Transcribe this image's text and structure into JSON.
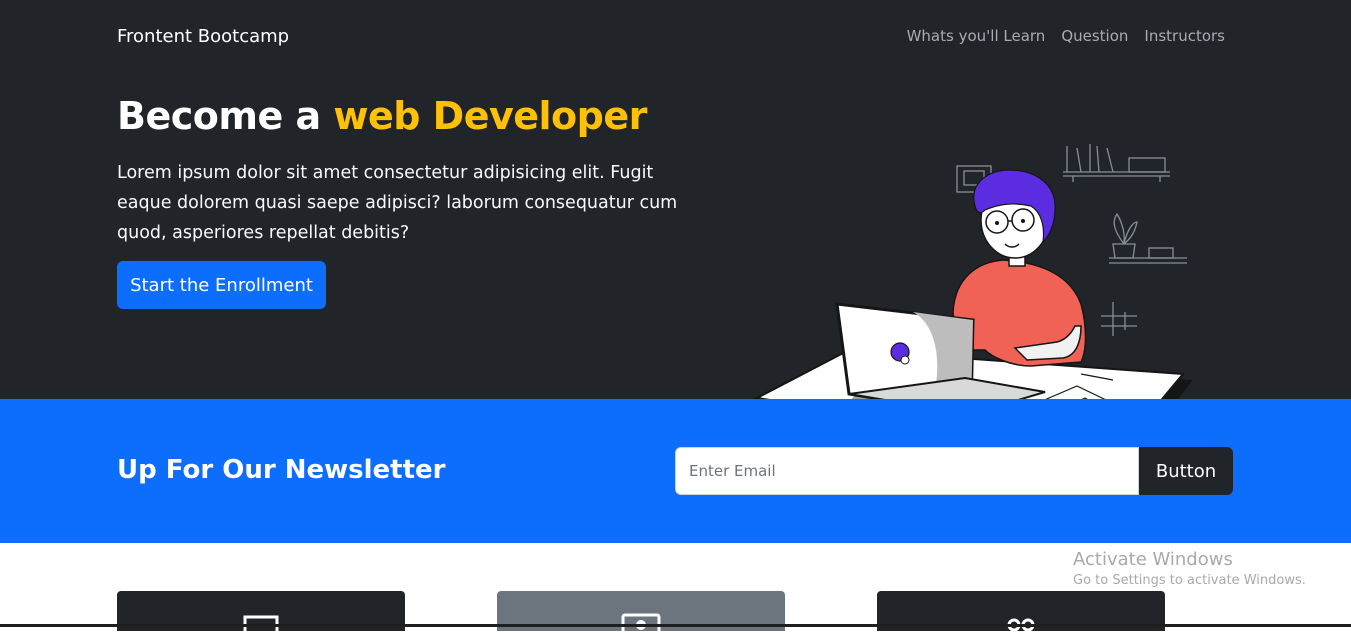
{
  "navbar": {
    "brand": "Frontent Bootcamp",
    "links": [
      "Whats you'll Learn",
      "Question",
      "Instructors"
    ]
  },
  "hero": {
    "title_prefix": "Become a ",
    "title_accent": "web Developer",
    "lead": "Lorem ipsum dolor sit amet consectetur adipisicing elit. Fugit eaque dolorem quasi saepe adipisci? laborum consequatur cum quod, asperiores repellat debitis?",
    "button_label": "Start the Enrollment"
  },
  "newsletter": {
    "title": "Up For Our Newsletter",
    "input_placeholder": "Enter Email",
    "button_label": "Button"
  },
  "watermark": {
    "title": "Activate Windows",
    "subtitle": "Go to Settings to activate Windows."
  },
  "cards": [
    {
      "icon": "laptop-icon"
    },
    {
      "icon": "person-badge-icon"
    },
    {
      "icon": "people-icon"
    }
  ],
  "colors": {
    "dark": "#212529",
    "primary": "#0d6efd",
    "accent": "#ffc107",
    "secondary": "#6c757d"
  }
}
